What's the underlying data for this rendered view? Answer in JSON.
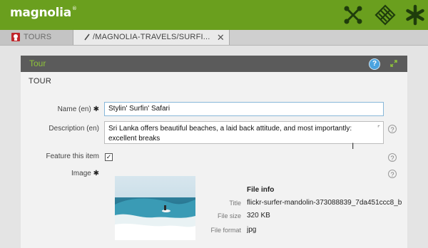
{
  "app": {
    "logo_text": "magnolia"
  },
  "topbar": {
    "icons": [
      "apps-crossed-icon",
      "pulse-diamond-icon",
      "favorites-asterisk-icon"
    ],
    "color": "#6a9f1e"
  },
  "tabs": [
    {
      "label": "TOURS",
      "icon": "tours-app-icon"
    },
    {
      "label": "/MAGNOLIA-TRAVELS/SURFI...",
      "icon": "edit-pencil-icon",
      "close": "✕"
    }
  ],
  "panel": {
    "title": "Tour",
    "help": "?",
    "section_title": "TOUR",
    "accent": "#8fc33a"
  },
  "form": {
    "name": {
      "label": "Name (en)",
      "required": "✱",
      "value": "Stylin' Surfin' Safari"
    },
    "description": {
      "label": "Description (en)",
      "value": "Sri Lanka offers beautiful beaches, a laid back attitude, and most importantly: excellent breaks"
    },
    "feature": {
      "label": "Feature this item",
      "checked": "✓"
    },
    "image": {
      "label": "Image",
      "required": "✱"
    }
  },
  "fileinfo": {
    "title": "File info",
    "rows": [
      {
        "label": "Title",
        "value": "flickr-surfer-mandolin-373088839_7da451ccc8_b"
      },
      {
        "label": "File size",
        "value": "320 KB"
      },
      {
        "label": "File format",
        "value": "jpg"
      }
    ]
  }
}
